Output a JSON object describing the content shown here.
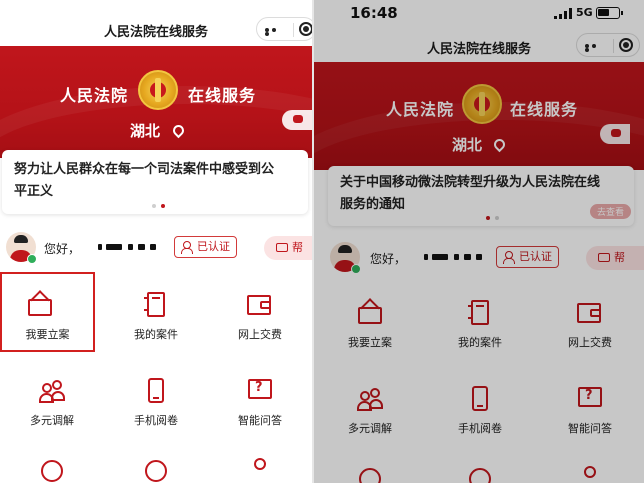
{
  "left": {
    "nav_title": "人民法院在线服务",
    "banner": {
      "brand_left": "人民法院",
      "brand_right": "在线服务",
      "province": "湖北"
    },
    "notice": {
      "line1": "努力让人民群众在每一个司法案件中感受到公",
      "line2": "平正义"
    },
    "user": {
      "greeting": "您好，",
      "certified_label": "已认证",
      "help_label": "帮"
    },
    "grid": [
      {
        "label": "我要立案",
        "icon": "envelope-icon"
      },
      {
        "label": "我的案件",
        "icon": "notebook-icon"
      },
      {
        "label": "网上交费",
        "icon": "wallet-icon"
      },
      {
        "label": "多元调解",
        "icon": "people-icon"
      },
      {
        "label": "手机阅卷",
        "icon": "phone-icon"
      },
      {
        "label": "智能问答",
        "icon": "question-icon"
      }
    ]
  },
  "right": {
    "status": {
      "time": "16:48",
      "network": "5G"
    },
    "nav_title": "人民法院在线服务",
    "banner": {
      "brand_left": "人民法院",
      "brand_right": "在线服务",
      "province": "湖北"
    },
    "notice": {
      "line1": "关于中国移动微法院转型升级为人民法院在线",
      "line2": "服务的通知",
      "badge": "去查看"
    },
    "user": {
      "greeting": "您好，",
      "certified_label": "已认证",
      "help_label": "帮"
    },
    "grid": [
      {
        "label": "我要立案",
        "icon": "envelope-icon"
      },
      {
        "label": "我的案件",
        "icon": "notebook-icon"
      },
      {
        "label": "网上交费",
        "icon": "wallet-icon"
      },
      {
        "label": "多元调解",
        "icon": "people-icon"
      },
      {
        "label": "手机阅卷",
        "icon": "phone-icon"
      },
      {
        "label": "智能问答",
        "icon": "question-icon"
      }
    ]
  },
  "colors": {
    "brand_red": "#c0161c",
    "gold": "#f3c640",
    "selection_outline": "#d2201f"
  }
}
